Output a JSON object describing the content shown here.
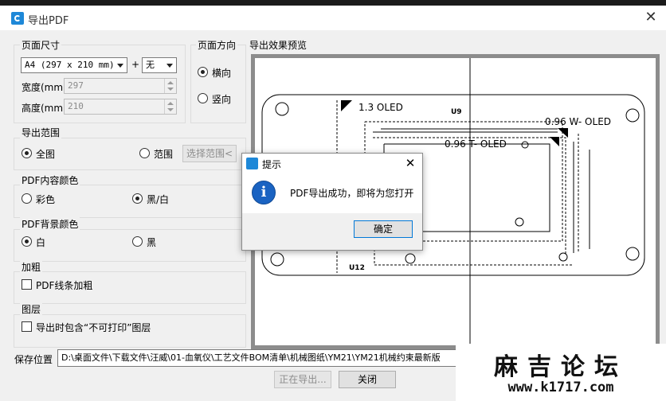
{
  "window": {
    "title": "导出PDF"
  },
  "page_size": {
    "group_label": "页面尺寸",
    "paper_select": "A4 (297 x 210 mm)",
    "plus_sign": "+",
    "margin_select": "无",
    "width_label": "宽度(mm)",
    "width_value": "297",
    "height_label": "高度(mm)",
    "height_value": "210"
  },
  "orientation": {
    "group_label": "页面方向",
    "landscape_label": "横向",
    "portrait_label": "竖向",
    "selected": "landscape"
  },
  "preview": {
    "label": "导出效果预览"
  },
  "export_range": {
    "group_label": "导出范围",
    "all_label": "全图",
    "range_label": "范围",
    "select_range_button": "选择范围<",
    "selected": "all"
  },
  "content_color": {
    "group_label": "PDF内容颜色",
    "color_label": "彩色",
    "bw_label": "黑/白",
    "selected": "bw"
  },
  "background_color": {
    "group_label": "PDF背景颜色",
    "white_label": "白",
    "black_label": "黑",
    "selected": "white"
  },
  "bold": {
    "group_label": "加粗",
    "checkbox_label": "PDF线条加粗",
    "checked": false
  },
  "layers": {
    "group_label": "图层",
    "checkbox_label": "导出时包含“不可打印”图层",
    "checked": false
  },
  "save": {
    "label": "保存位置",
    "path": "D:\\桌面文件\\下载文件\\汪威\\01-血氧仪\\工艺文件BOM清单\\机械图纸\\YM21\\YM21机械约束最新版"
  },
  "buttons": {
    "exporting": "正在导出...",
    "close": "关闭"
  },
  "drawing": {
    "label_oled_13": "1.3 OLED",
    "label_u9": "U9",
    "label_096_w": "0.96   W- OLED",
    "label_096_t": "0.96   T- OLED",
    "label_u12": "U12"
  },
  "popup": {
    "title": "提示",
    "message": "PDF导出成功，即将为您打开",
    "ok_button": "确定"
  },
  "watermark": {
    "title": "麻吉论坛",
    "url": "www.k1717.com"
  },
  "colors": {
    "accent": "#1e88d8",
    "info_icon": "#1a63c2",
    "preview_frame": "#8c8c8c"
  }
}
